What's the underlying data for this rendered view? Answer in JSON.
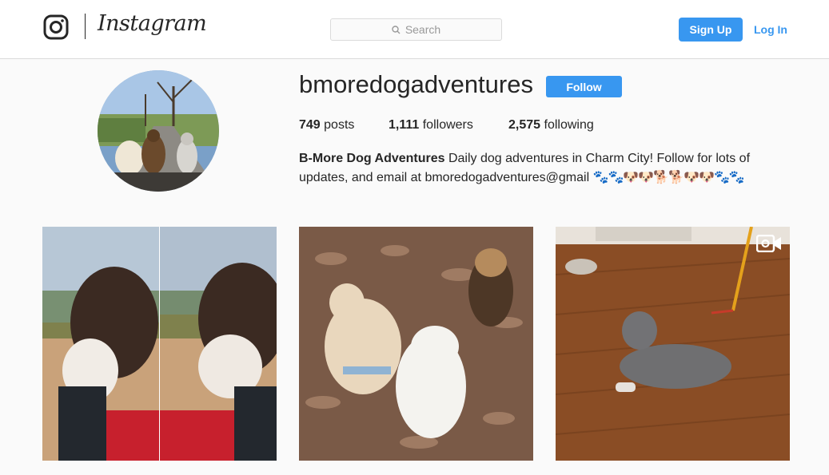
{
  "header": {
    "brand": "Instagram",
    "search_placeholder": "Search",
    "signup_label": "Sign Up",
    "login_label": "Log In",
    "accent_color": "#3897f0"
  },
  "profile": {
    "username": "bmoredogadventures",
    "follow_label": "Follow",
    "stats": {
      "posts_count": "749",
      "posts_label": "posts",
      "followers_count": "1,111",
      "followers_label": "followers",
      "following_count": "2,575",
      "following_label": "following"
    },
    "bio": {
      "name": "B-More Dog Adventures",
      "text_line1": " Daily dog adventures in Charm City! Follow for lots of",
      "text_line2": "updates, and email at bmoredogadventures@gmail ",
      "emoji": "🐾🐾🐶🐶🐕🐕🐶🐶🐾🐾"
    }
  },
  "posts": [
    {
      "id": "post-1",
      "subject": "two dog portraits side by side",
      "icon": null
    },
    {
      "id": "post-2",
      "subject": "three dogs on leaves",
      "icon": null
    },
    {
      "id": "post-3",
      "subject": "cat on wooden floor",
      "icon": "video-camera-icon"
    }
  ]
}
